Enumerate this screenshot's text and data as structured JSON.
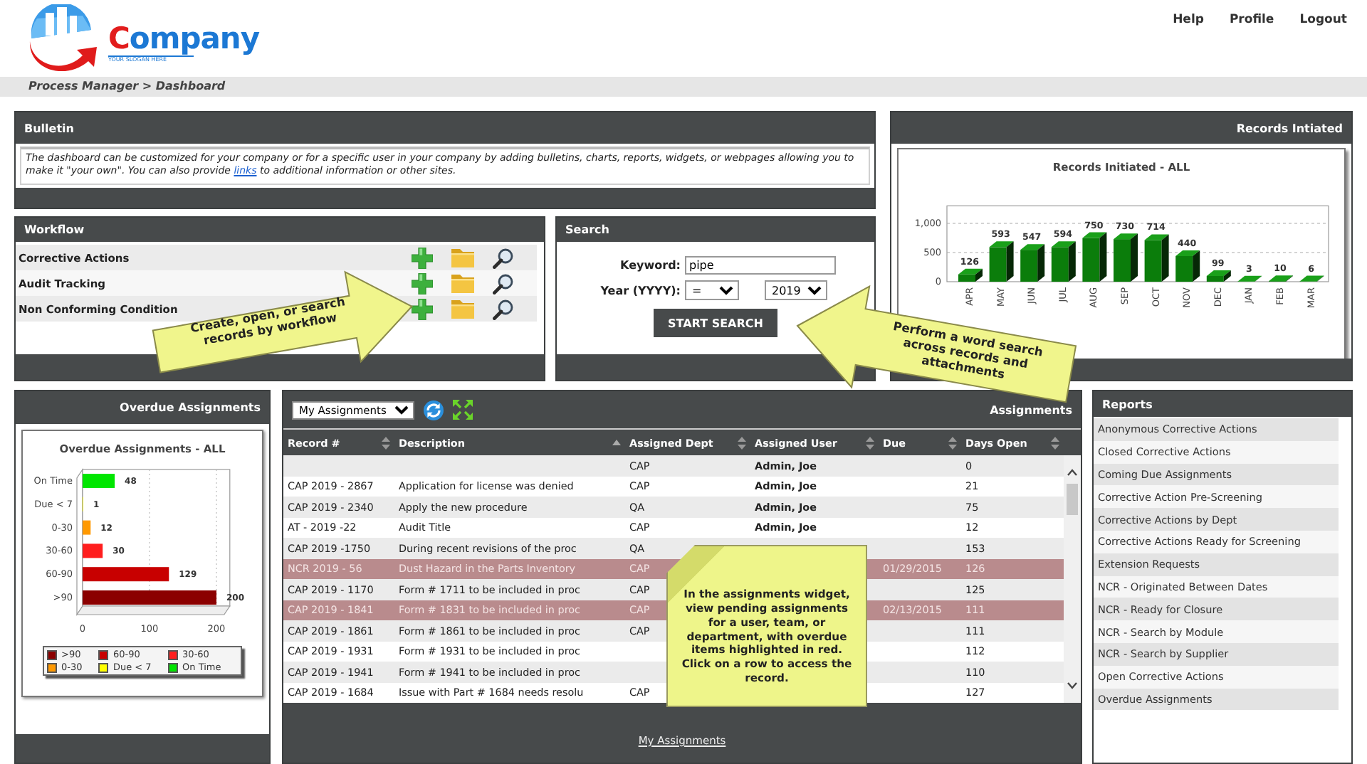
{
  "header": {
    "company": "Company",
    "slogan": "YOUR SLOGAN HERE",
    "links": [
      "Help",
      "Profile",
      "Logout"
    ]
  },
  "breadcrumb": "Process Manager > Dashboard",
  "bulletin": {
    "title": "Bulletin",
    "text": "The dashboard can be customized for your company or for a specific user in your company by adding bulletins, charts, reports, widgets, or webpages allowing you to make it \"your own\". You can also provide ",
    "link": "links",
    "text_after": " to additional information or other sites."
  },
  "workflow": {
    "title": "Workflow",
    "rows": [
      "Corrective Actions",
      "Audit Tracking",
      "Non Conforming Condition"
    ]
  },
  "search": {
    "title": "Search",
    "keyword_label": "Keyword:",
    "keyword": {
      "value": "pipe"
    },
    "year_label": "Year (YYYY):",
    "operator": "=",
    "year": "2019",
    "button": "START SEARCH"
  },
  "records": {
    "title": "Records Intiated",
    "chart_data": {
      "type": "bar",
      "title": "Records Initiated - ALL",
      "categories": [
        "APR",
        "MAY",
        "JUN",
        "JUL",
        "AUG",
        "SEP",
        "OCT",
        "NOV",
        "DEC",
        "JAN",
        "FEB",
        "MAR"
      ],
      "values": [
        126,
        593,
        547,
        594,
        750,
        730,
        714,
        440,
        99,
        3,
        10,
        6
      ],
      "yticks": [
        0,
        500,
        {
          "value": 1000,
          "label": "1,000"
        }
      ],
      "ylim": [
        0,
        1300
      ],
      "data_labels": true
    }
  },
  "overdue": {
    "title": "Overdue Assignments",
    "chart_data": {
      "type": "bar",
      "orientation": "horizontal",
      "title": "Overdue Assignments - ALL",
      "categories": [
        "On Time",
        "Due < 7",
        "0-30",
        "30-60",
        "60-90",
        ">90"
      ],
      "values": [
        48,
        1,
        12,
        30,
        129,
        200
      ],
      "xticks": [
        0,
        100,
        200
      ],
      "xlim": [
        0,
        220
      ],
      "data_labels": true
    },
    "legend": [
      {
        "label": ">90",
        "color": "#8b0000"
      },
      {
        "label": "60-90",
        "color": "#c80000"
      },
      {
        "label": "30-60",
        "color": "#ff1e1e"
      },
      {
        "label": "0-30",
        "color": "#ff9900"
      },
      {
        "label": "Due < 7",
        "color": "#ffff00"
      },
      {
        "label": "On Time",
        "color": "#00e600"
      }
    ]
  },
  "assignments": {
    "view": "My Assignments",
    "title": "Assignments",
    "columns": [
      {
        "label": "Record #",
        "sorted": false
      },
      {
        "label": "Description",
        "sorted": true
      },
      {
        "label": "Assigned Dept",
        "sorted": false
      },
      {
        "label": "Assigned User",
        "sorted": false
      },
      {
        "label": "Due",
        "sorted": false
      },
      {
        "label": "Days Open",
        "sorted": false
      }
    ],
    "rows": [
      {
        "dept": "CAP",
        "user": "Admin, Joe",
        "days": "0",
        "overdue": false
      },
      {
        "record": "CAP 2019 - 2867",
        "description": "Application for license was denied",
        "dept": "CAP",
        "user": "Admin, Joe",
        "days": "21",
        "overdue": false
      },
      {
        "record": "CAP 2019 - 2340",
        "description": "Apply the new procedure",
        "dept": "QA",
        "user": "Admin, Joe",
        "days": "75",
        "overdue": false
      },
      {
        "record": "AT - 2019 -22",
        "description": "Audit Title",
        "dept": "CAP",
        "user": "Admin, Joe",
        "days": "12",
        "overdue": false
      },
      {
        "record": "CAP 2019 -1750",
        "description": "During recent revisions of the proc",
        "dept": "QA",
        "days": "153",
        "overdue": false
      },
      {
        "record": "NCR 2019 - 56",
        "description": "Dust Hazard in the Parts Inventory",
        "dept": "CAP",
        "due": "01/29/2015",
        "days": "126",
        "overdue": true
      },
      {
        "record": "CAP 2019 - 1170",
        "description": "Form # 1711 to be included in proc",
        "dept": "CAP",
        "days": "125",
        "overdue": false
      },
      {
        "record": "CAP 2019 - 1841",
        "description": "Form # 1831 to be included in proc",
        "dept": "CAP",
        "due": "02/13/2015",
        "days": "111",
        "overdue": true
      },
      {
        "record": "CAP 2019 - 1861",
        "description": "Form # 1861 to be included in proc",
        "dept": "CAP",
        "days": "111",
        "overdue": false
      },
      {
        "record": "CAP 2019 - 1931",
        "description": "Form # 1931 to be included in proc",
        "days": "112",
        "overdue": false
      },
      {
        "record": "CAP 2019 - 1941",
        "description": "Form # 1941 to be included in proc",
        "days": "110",
        "overdue": false
      },
      {
        "record": "CAP 2019 - 1684",
        "description": "Issue with Part # 1684 needs resolu",
        "dept": "CAP",
        "days": "127",
        "overdue": false
      }
    ],
    "footer_link": "My Assignments"
  },
  "reports": {
    "title": "Reports",
    "items": [
      "Anonymous Corrective Actions",
      "Closed Corrective Actions",
      "Coming Due Assignments",
      "Corrective Action Pre-Screening",
      "Corrective Actions by Dept",
      "Corrective Actions Ready for Screening",
      "Extension Requests",
      "NCR - Originated Between Dates",
      "NCR - Ready for Closure",
      "NCR - Search by Module",
      "NCR - Search by Supplier",
      "Open Corrective Actions",
      "Overdue Assignments"
    ]
  },
  "callouts": [
    {
      "kind": "arrow-right",
      "text": "Create, open, or search records by workflow"
    },
    {
      "kind": "arrow-left",
      "text": "Perform a word search across records and attachments"
    },
    {
      "kind": "note",
      "text": "In the assignments widget, view pending assignments for a user, team, or department, with overdue items highlighted in red. Click on a row to access the record."
    }
  ]
}
